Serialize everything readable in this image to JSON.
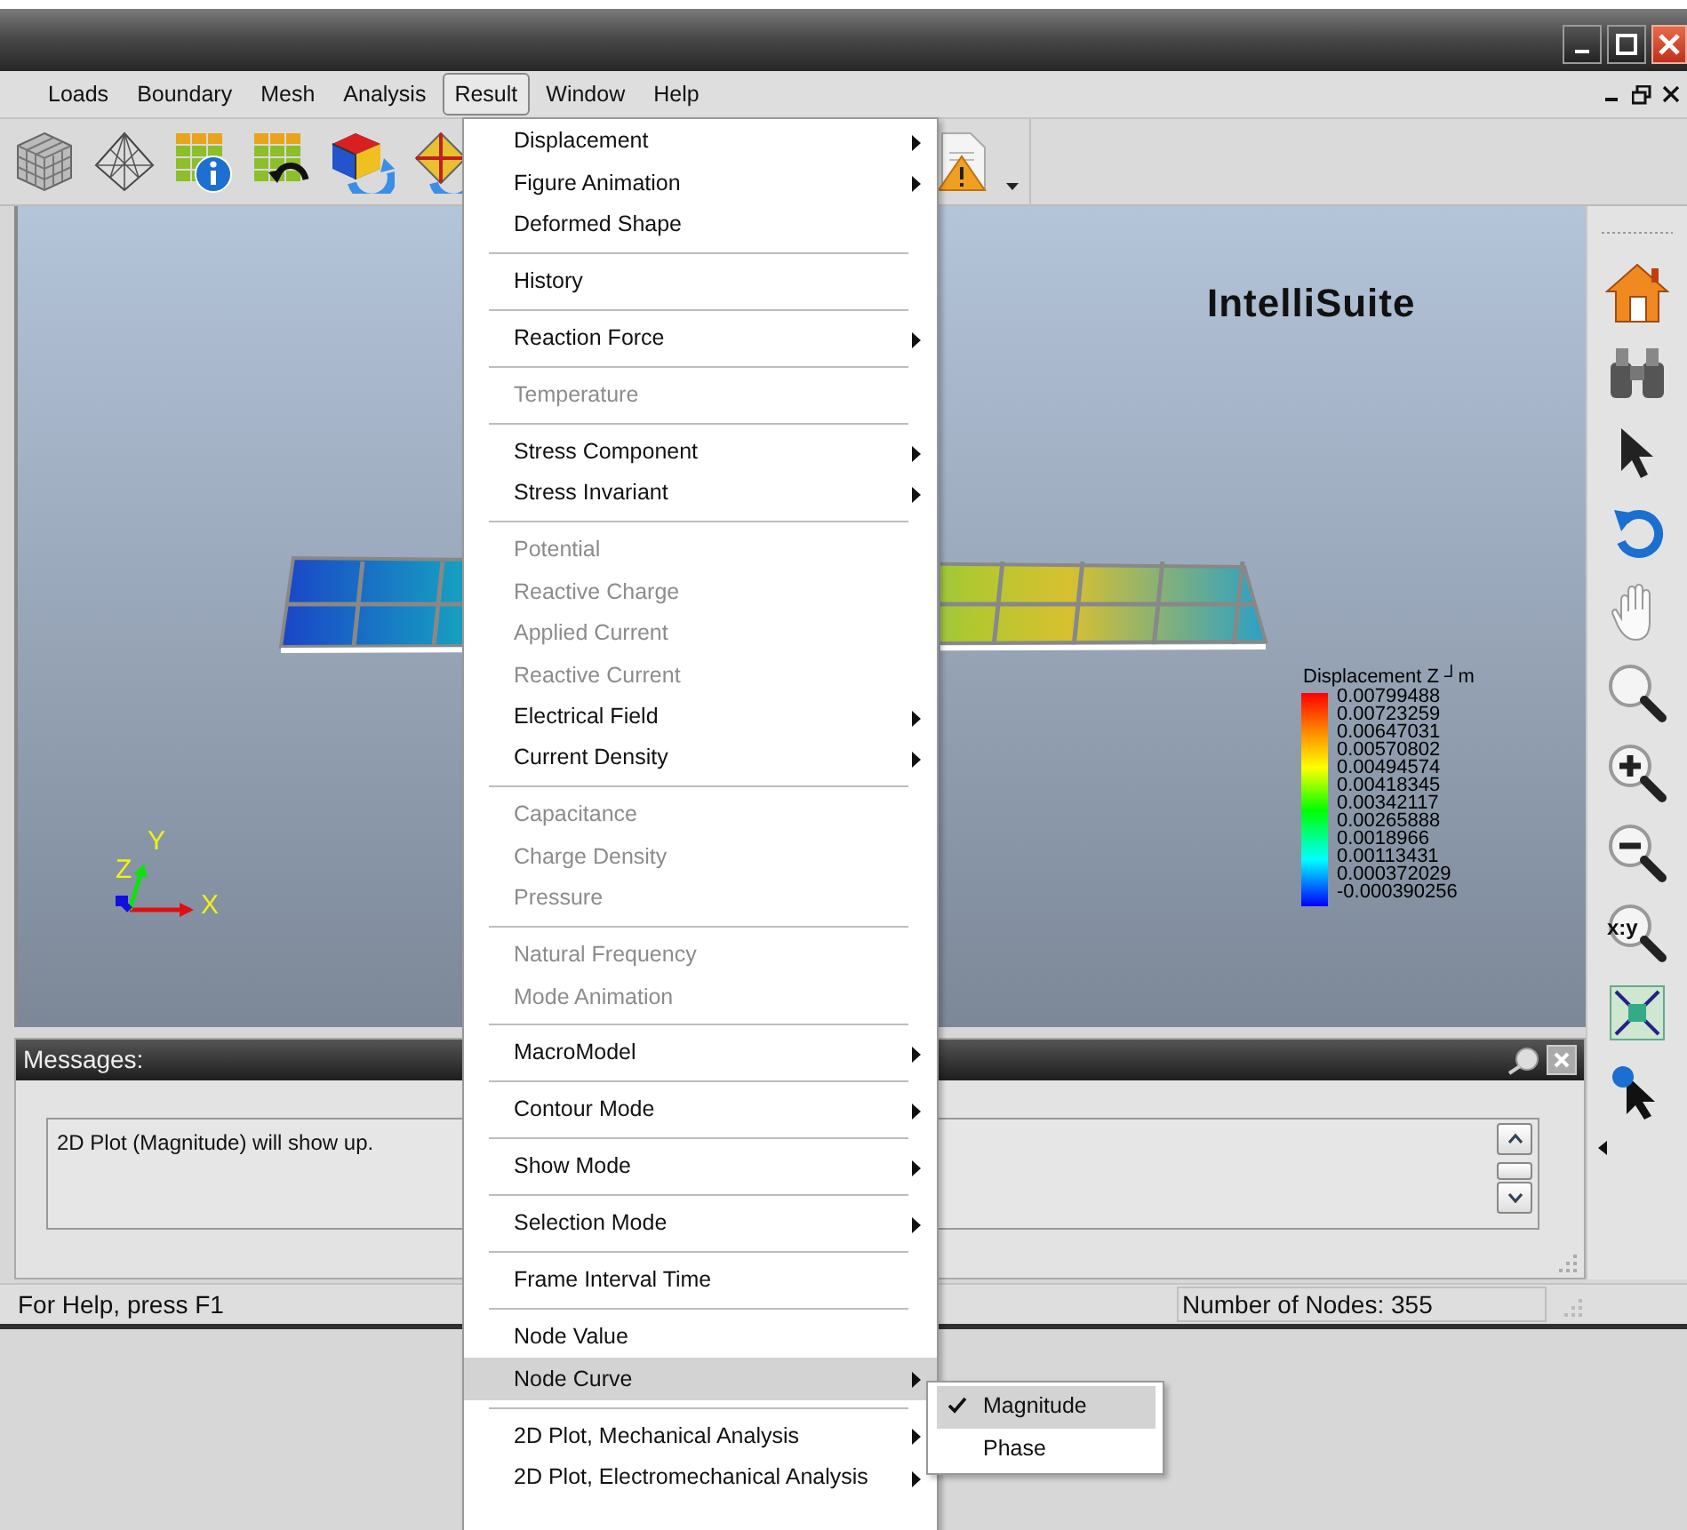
{
  "menu_bar": [
    {
      "label": "Loads",
      "selected": false
    },
    {
      "label": "Boundary",
      "selected": false
    },
    {
      "label": "Mesh",
      "selected": false
    },
    {
      "label": "Analysis",
      "selected": false
    },
    {
      "label": "Result",
      "selected": true
    },
    {
      "label": "Window",
      "selected": false
    },
    {
      "label": "Help",
      "selected": false
    }
  ],
  "result_menu": [
    {
      "kind": "item",
      "label": "Displacement",
      "submenu": true,
      "disabled": false,
      "highlighted": false
    },
    {
      "kind": "item",
      "label": "Figure Animation",
      "submenu": true,
      "disabled": false,
      "highlighted": false
    },
    {
      "kind": "item",
      "label": "Deformed Shape",
      "submenu": false,
      "disabled": false,
      "highlighted": false
    },
    {
      "kind": "separator"
    },
    {
      "kind": "item",
      "label": "History",
      "submenu": false,
      "disabled": false,
      "highlighted": false
    },
    {
      "kind": "separator"
    },
    {
      "kind": "item",
      "label": "Reaction Force",
      "submenu": true,
      "disabled": false,
      "highlighted": false
    },
    {
      "kind": "separator"
    },
    {
      "kind": "item",
      "label": "Temperature",
      "submenu": false,
      "disabled": true,
      "highlighted": false
    },
    {
      "kind": "separator"
    },
    {
      "kind": "item",
      "label": "Stress Component",
      "submenu": true,
      "disabled": false,
      "highlighted": false
    },
    {
      "kind": "item",
      "label": "Stress Invariant",
      "submenu": true,
      "disabled": false,
      "highlighted": false
    },
    {
      "kind": "separator"
    },
    {
      "kind": "item",
      "label": "Potential",
      "submenu": false,
      "disabled": true,
      "highlighted": false
    },
    {
      "kind": "item",
      "label": "Reactive Charge",
      "submenu": false,
      "disabled": true,
      "highlighted": false
    },
    {
      "kind": "item",
      "label": "Applied Current",
      "submenu": false,
      "disabled": true,
      "highlighted": false
    },
    {
      "kind": "item",
      "label": "Reactive Current",
      "submenu": false,
      "disabled": true,
      "highlighted": false
    },
    {
      "kind": "item",
      "label": "Electrical Field",
      "submenu": true,
      "disabled": false,
      "highlighted": false
    },
    {
      "kind": "item",
      "label": "Current Density",
      "submenu": true,
      "disabled": false,
      "highlighted": false
    },
    {
      "kind": "separator"
    },
    {
      "kind": "item",
      "label": "Capacitance",
      "submenu": false,
      "disabled": true,
      "highlighted": false
    },
    {
      "kind": "item",
      "label": "Charge Density",
      "submenu": false,
      "disabled": true,
      "highlighted": false
    },
    {
      "kind": "item",
      "label": "Pressure",
      "submenu": false,
      "disabled": true,
      "highlighted": false
    },
    {
      "kind": "separator"
    },
    {
      "kind": "item",
      "label": "Natural Frequency",
      "submenu": false,
      "disabled": true,
      "highlighted": false
    },
    {
      "kind": "item",
      "label": "Mode Animation",
      "submenu": false,
      "disabled": true,
      "highlighted": false
    },
    {
      "kind": "separator"
    },
    {
      "kind": "item",
      "label": "MacroModel",
      "submenu": true,
      "disabled": false,
      "highlighted": false
    },
    {
      "kind": "separator"
    },
    {
      "kind": "item",
      "label": "Contour Mode",
      "submenu": true,
      "disabled": false,
      "highlighted": false
    },
    {
      "kind": "separator"
    },
    {
      "kind": "item",
      "label": "Show Mode",
      "submenu": true,
      "disabled": false,
      "highlighted": false
    },
    {
      "kind": "separator"
    },
    {
      "kind": "item",
      "label": "Selection Mode",
      "submenu": true,
      "disabled": false,
      "highlighted": false
    },
    {
      "kind": "separator"
    },
    {
      "kind": "item",
      "label": "Frame Interval Time",
      "submenu": false,
      "disabled": false,
      "highlighted": false
    },
    {
      "kind": "separator"
    },
    {
      "kind": "item",
      "label": "Node Value",
      "submenu": false,
      "disabled": false,
      "highlighted": false
    },
    {
      "kind": "item",
      "label": "Node Curve",
      "submenu": true,
      "disabled": false,
      "highlighted": true
    },
    {
      "kind": "separator"
    },
    {
      "kind": "item",
      "label": "2D Plot, Mechanical Analysis",
      "submenu": true,
      "disabled": false,
      "highlighted": false
    },
    {
      "kind": "item",
      "label": "2D Plot, Electromechanical Analysis",
      "submenu": true,
      "disabled": false,
      "highlighted": false
    }
  ],
  "node_curve_submenu": [
    {
      "label": "Magnitude",
      "checked": true,
      "highlighted": true
    },
    {
      "label": "Phase",
      "checked": false,
      "highlighted": false
    }
  ],
  "viewport": {
    "logo": "IntelliSuite",
    "legend_title": "Displacement Z ┘m",
    "legend_values": [
      "0.00799488",
      "0.00723259",
      "0.00647031",
      "0.00570802",
      "0.00494574",
      "0.00418345",
      "0.00342117",
      "0.00265888",
      "0.0018966",
      "0.00113431",
      "0.000372029",
      "-0.000390256"
    ],
    "axis_labels": {
      "x": "X",
      "y": "Y",
      "z": "Z"
    }
  },
  "right_toolbar": {
    "xy_zoom_label": "x:y"
  },
  "messages": {
    "title": "Messages:",
    "text": "2D Plot (Magnitude) will show up."
  },
  "status_bar": {
    "help": "For Help, press F1",
    "node_count": "Number of Nodes: 355"
  }
}
